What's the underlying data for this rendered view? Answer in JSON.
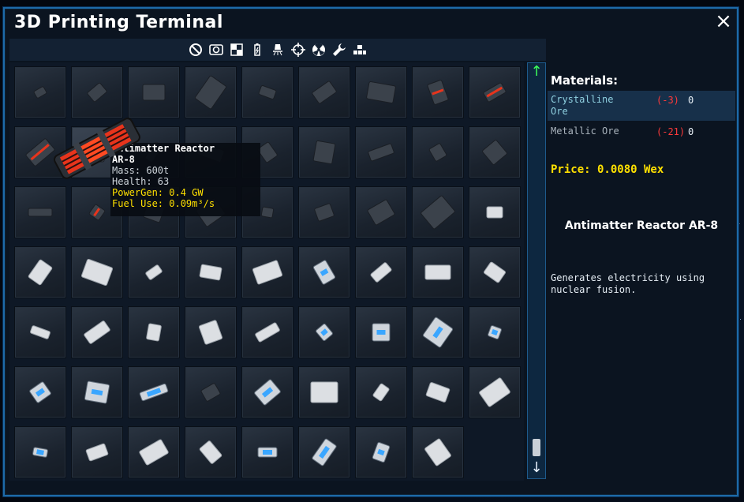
{
  "window": {
    "title": "3D Printing Terminal",
    "close_icon": "×"
  },
  "toolbar": {
    "icons": [
      "no-entry-icon",
      "camera-icon",
      "checker-icon",
      "battery-icon",
      "thruster-icon",
      "crosshair-icon",
      "radiation-icon",
      "wrench-icon",
      "blocks-icon"
    ]
  },
  "scroll": {
    "up": "↑",
    "down": "↓"
  },
  "materials": {
    "title": "Materials:",
    "rows": [
      {
        "name": "Crystalline Ore",
        "need": "(-3)",
        "have": "0"
      },
      {
        "name": "Metallic Ore",
        "need": "(-21)",
        "have": "0"
      }
    ]
  },
  "price": "Price: 0.0080 Wex",
  "selected": {
    "name": "Antimatter Reactor AR-8",
    "description": "Generates electricity using nuclear fusion."
  },
  "tooltip": {
    "name": "Antimatter Reactor",
    "model": "AR-8",
    "mass": "Mass: 600t",
    "health": "Health: 63",
    "powergen": "PowerGen: 0.4 GW",
    "fuel": "Fuel Use: 0.09m³/s"
  },
  "colors": {
    "accent": "#1d6aa8",
    "yellow": "#ffe000",
    "red": "#ff3a3a",
    "green": "#3cff5a"
  }
}
